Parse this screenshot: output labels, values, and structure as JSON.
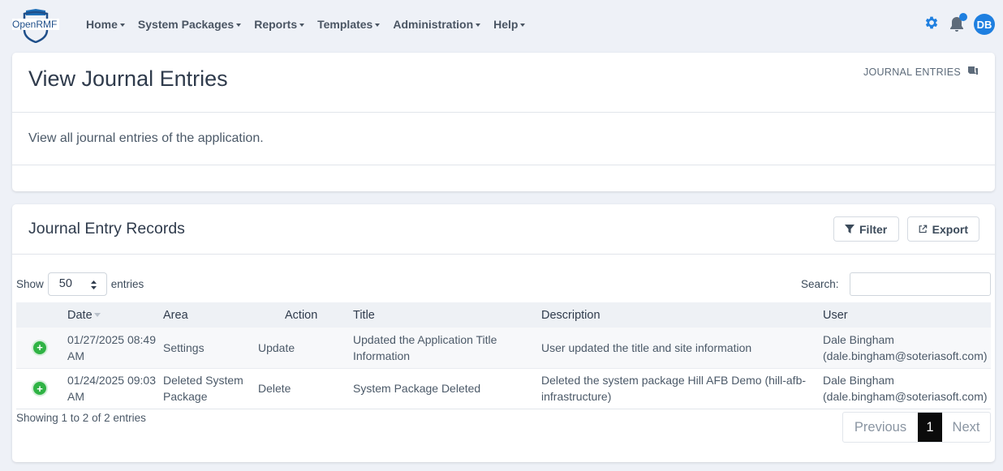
{
  "app": {
    "logo_text": "OpenRMF"
  },
  "nav": {
    "items": [
      {
        "label": "Home"
      },
      {
        "label": "System Packages"
      },
      {
        "label": "Reports"
      },
      {
        "label": "Templates"
      },
      {
        "label": "Administration"
      },
      {
        "label": "Help"
      }
    ],
    "user_initials": "DB",
    "accent": "#1e7fe0"
  },
  "header_card": {
    "title": "View Journal Entries",
    "breadcrumb": "JOURNAL ENTRIES",
    "description": "View all journal entries of the application."
  },
  "records_card": {
    "title": "Journal Entry Records",
    "filter_label": "Filter",
    "export_label": "Export",
    "show_label": "Show",
    "page_size": "50",
    "entries_label": "entries",
    "search_label": "Search:",
    "search_value": "",
    "columns": [
      "Date",
      "Area",
      "Action",
      "Title",
      "Description",
      "User"
    ],
    "rows": [
      {
        "date": "01/27/2025 08:49 AM",
        "area": "Settings",
        "action": "Update",
        "title": "Updated the Application Title Information",
        "description": "User updated the title and site information",
        "user": "Dale Bingham (dale.bingham@soteriasoft.com)"
      },
      {
        "date": "01/24/2025 09:03 AM",
        "area": "Deleted System Package",
        "action": "Delete",
        "title": "System Package Deleted",
        "description": "Deleted the system package Hill AFB Demo (hill-afb-infrastructure)",
        "user": "Dale Bingham (dale.bingham@soteriasoft.com)"
      }
    ],
    "info": "Showing 1 to 2 of 2 entries",
    "pagination": {
      "previous": "Previous",
      "current": "1",
      "next": "Next"
    }
  },
  "icons": [
    "openrmf-shield-logo",
    "gear-icon",
    "bell-icon",
    "journal-icon",
    "filter-icon",
    "export-icon",
    "expand-row-icon",
    "sort-desc-icon"
  ]
}
